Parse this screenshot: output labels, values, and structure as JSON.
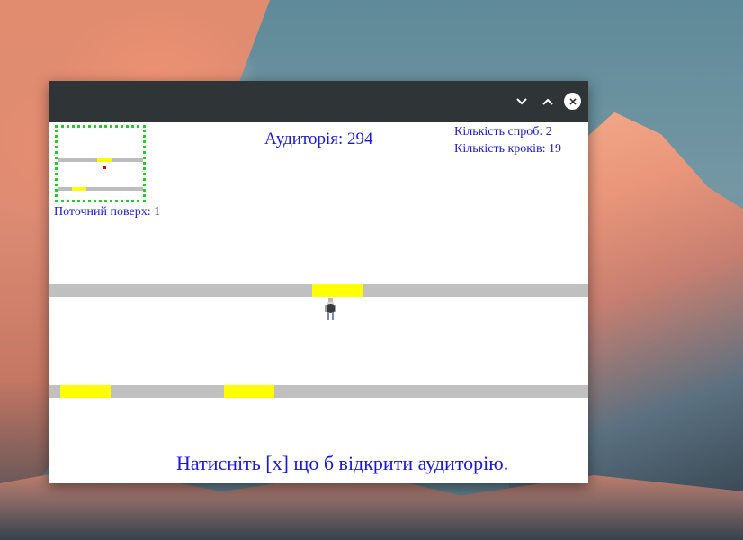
{
  "window": {
    "minimize_glyph": "⌄",
    "maximize_glyph": "⌃",
    "close_glyph": "✕"
  },
  "hud": {
    "room_label": "Аудиторія: 294",
    "attempts_label": "Кількість спроб: 2",
    "steps_label": "Кількість кроків: 19",
    "current_floor_label": "Поточний поверх: 1",
    "hint": "Натисніть [x] що б відкрити аудиторію."
  },
  "colors": {
    "text": "#1a1ad6",
    "floor": "#c0c0c0",
    "door": "#ffff00",
    "minimap_border": "#22cc22",
    "minimap_player": "#e00000",
    "titlebar": "#2f3437"
  },
  "icons": {
    "player": "student-sprite",
    "minimize": "chevron-down-icon",
    "maximize": "chevron-up-icon",
    "close": "close-icon"
  }
}
